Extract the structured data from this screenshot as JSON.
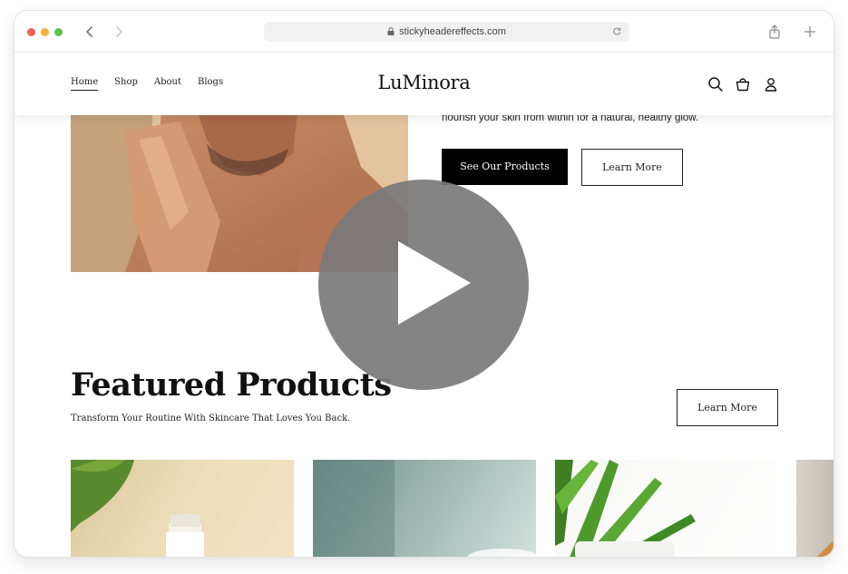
{
  "browser": {
    "url": "stickyheadereffects.com"
  },
  "header": {
    "logo": "LuMinora",
    "menu": [
      {
        "label": "Home",
        "active": true
      },
      {
        "label": "Shop",
        "active": false
      },
      {
        "label": "About",
        "active": false
      },
      {
        "label": "Blogs",
        "active": false
      }
    ],
    "icons": [
      "search-icon",
      "shopping-bag-icon",
      "user-icon"
    ]
  },
  "hero": {
    "text": "nourish your skin from within for a natural, healthy glow.",
    "primary_button": "See Our Products",
    "secondary_button": "Learn More"
  },
  "featured": {
    "title": "Featured Products",
    "subtitle": "Transform Your Routine With Skincare That Loves You Back.",
    "button": "Learn More"
  },
  "overlay": {
    "icon": "play-icon"
  },
  "colors": {
    "accent": "#000000",
    "overlay": "#7a7a7a"
  }
}
